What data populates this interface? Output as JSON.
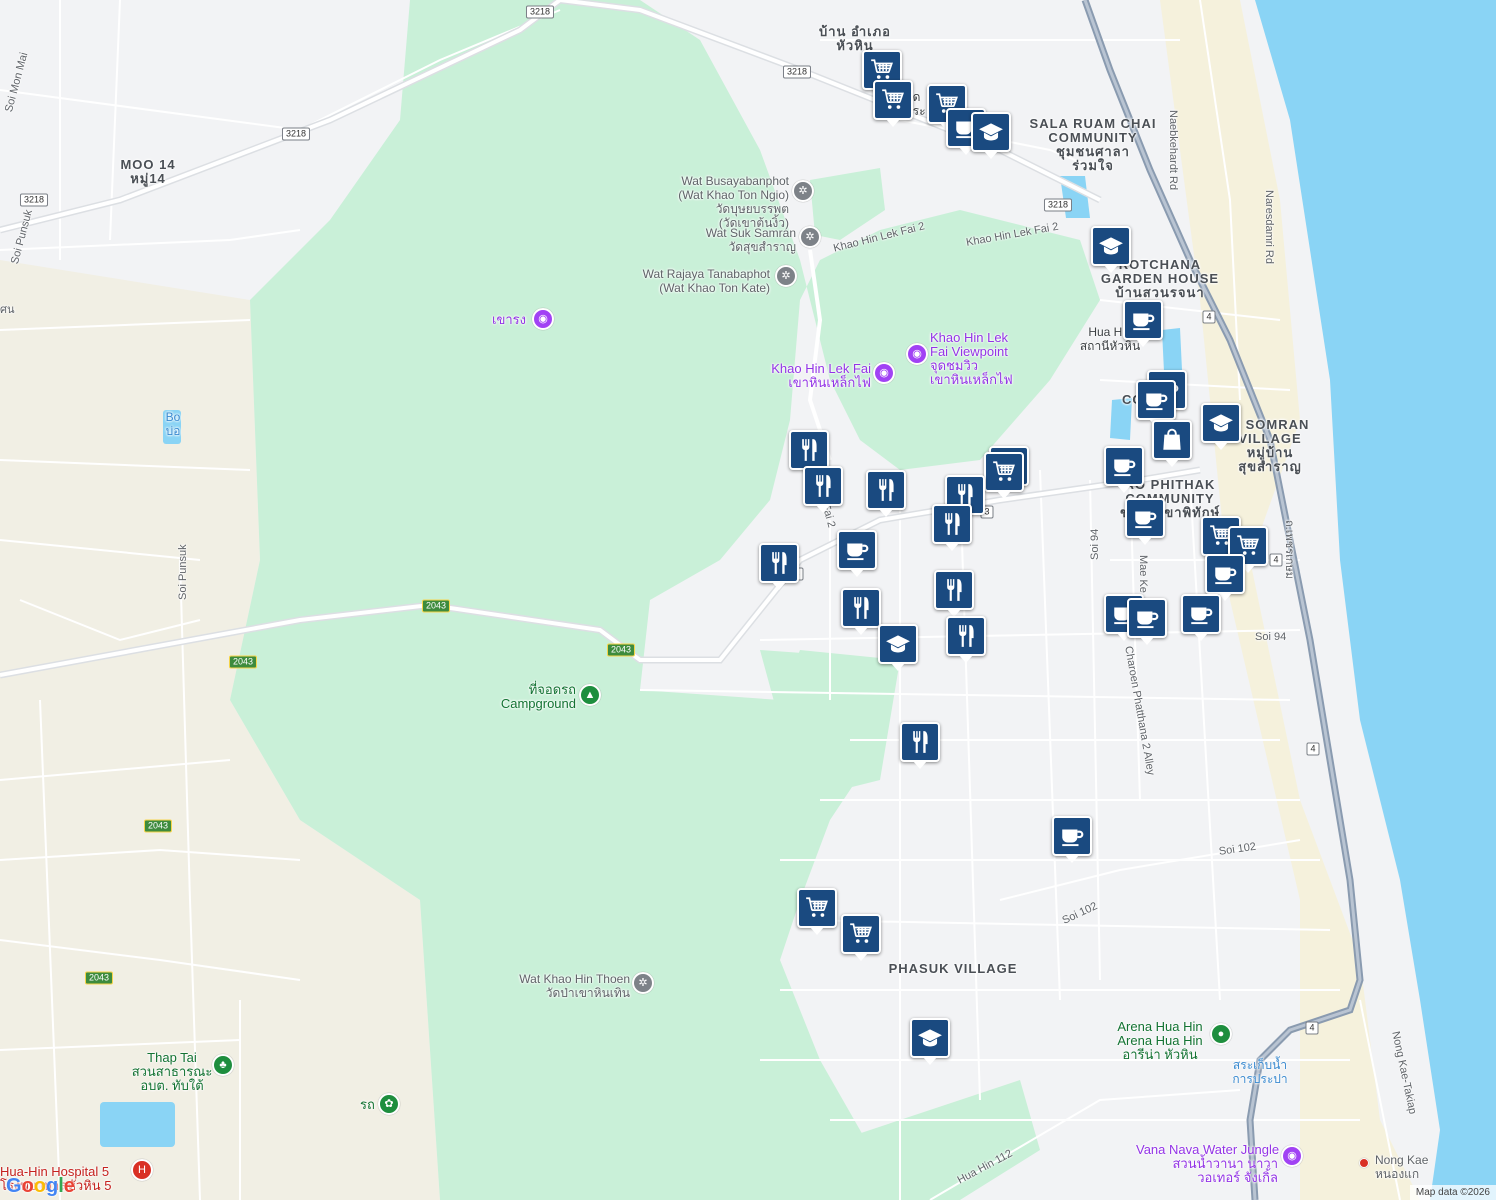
{
  "map": {
    "area_labels": [
      {
        "id": "ban-amphoe",
        "line1": "บ้าน อำเภอ",
        "line2": "หัวหิน"
      },
      {
        "id": "moo14",
        "line1": "MOO 14",
        "line2": "หมู่14"
      },
      {
        "id": "sala-ruam-chai",
        "line1": "SALA RUAM CHAI",
        "line2": "COMMUNITY",
        "line3": "ชุมชนศาลา",
        "line4": "ร่วมใจ"
      },
      {
        "id": "rotchana",
        "line1": "ROTCHANA",
        "line2": "GARDEN HOUSE",
        "line3": "บ้านสวนรจนา"
      },
      {
        "id": "somran",
        "line1": "K SOMRAN",
        "line2": "VILLAGE",
        "line3": "หมู่บ้าน",
        "line4": "สุขสำราญ"
      },
      {
        "id": "phithak",
        "line1": "AO PHITHAK",
        "line2": "COMMUNITY",
        "line3": "ชุมชนเขาพิทักษ์"
      },
      {
        "id": "phasuk",
        "line1": "PHASUK VILLAGE"
      },
      {
        "id": "con",
        "line1": "CON"
      }
    ],
    "poi_labels": [
      {
        "id": "wat-busaya",
        "line1": "Wat Busayabanphot",
        "line2": "(Wat Khao Ton Ngio)",
        "line3": "วัดบุษยบรรพต",
        "line4": "(วัดเขาต้นงิ้ว)",
        "icon": "temple-icon"
      },
      {
        "id": "wat-suk",
        "line1": "Wat Suk Samran",
        "line2": "วัดสุขสำราญ",
        "icon": "temple-icon"
      },
      {
        "id": "wat-rajaya",
        "line1": "Wat Rajaya Tanabaphot",
        "line2": "(Wat Khao Ton Kate)",
        "icon": "temple-icon"
      },
      {
        "id": "khao-rang",
        "line1": "เขารง",
        "icon": "camera-icon"
      },
      {
        "id": "viewpoint",
        "line1": "Khao Hin Lek",
        "line2": "Fai Viewpoint",
        "line3": "จุดชมวิว",
        "line4": "เขาหินเหล็กไฟ",
        "icon": "camera-icon"
      },
      {
        "id": "khao-hin",
        "line1": "Khao Hin Lek Fai",
        "line2": "เขาหินเหล็กไฟ",
        "icon": "camera-icon"
      },
      {
        "id": "campground",
        "line1": "ที่จอดรถ",
        "line2": "Campground",
        "icon": "tent-icon"
      },
      {
        "id": "wat-thoen",
        "line1": "Wat Khao Hin Thoen",
        "line2": "วัดป่าเขาหินเทิน",
        "icon": "temple-icon"
      },
      {
        "id": "thap-tai",
        "line1": "Thap Tai",
        "line2": "สวนสาธารณะ",
        "line3": "อบต. ทับใต้",
        "icon": "park-icon"
      },
      {
        "id": "rot",
        "line1": "รถ",
        "icon": "flower-icon"
      },
      {
        "id": "hospital",
        "line1": "Hua-Hin Hospital 5",
        "line2": "โรงพยาบาลหัวหิน 5",
        "icon": "hospital-icon"
      },
      {
        "id": "arena",
        "line1": "Arena Hua Hin",
        "line2": "Arena Hua Hin",
        "line3": "อารีน่า หัวหิน",
        "icon": "stadium-icon"
      },
      {
        "id": "water",
        "line1": "สระเก็บน้ำ",
        "line2": "การประปา"
      },
      {
        "id": "vana-nava",
        "line1": "Vana Nava Water Jungle",
        "line2": "สวนน้ำวานา นาวา",
        "line3": "วอเทอร์ จังเกิ้ล",
        "icon": "waterpark-icon"
      },
      {
        "id": "nong-kae",
        "line1": "Nong Kae",
        "line2": "หนองแก",
        "icon": "pin-icon"
      },
      {
        "id": "hua-hin-station",
        "line1": "Hua Hin",
        "line2": "สถานีหัวหิน"
      },
      {
        "id": "bo",
        "line1": "Bo",
        "line2": "บ่อ"
      },
      {
        "id": "ban-prachuap",
        "line1": "บด",
        "line2": "ประ"
      }
    ],
    "road_labels": [
      "Soi Mon Mai",
      "Soi Punsuk",
      "Soi Punsuk",
      "Khao Hin Lek Fai 2",
      "Khao Hin Lek Fai 2",
      "Naebkehardt Rd",
      "Naresdamri Rd",
      "Soi 94",
      "Soi 94",
      "Mae Ke",
      "Charoen Phatthana 2 Alley",
      "Soi 102",
      "Soi 102",
      "Hua Hin 112",
      "Nong Kae-Takiap",
      "ถ.เพชรเกษม",
      "Fai 2",
      "ศน"
    ],
    "shields": [
      "3218",
      "3218",
      "3218",
      "3218",
      "3218",
      "2043",
      "2043",
      "2043",
      "2043",
      "2043",
      "4",
      "4",
      "4",
      "4",
      "3",
      "3"
    ],
    "markers": [
      {
        "type": "shopping-cart"
      },
      {
        "type": "shopping-cart"
      },
      {
        "type": "shopping-cart"
      },
      {
        "type": "coffee"
      },
      {
        "type": "school"
      },
      {
        "type": "school"
      },
      {
        "type": "coffee"
      },
      {
        "type": "coffee"
      },
      {
        "type": "coffee"
      },
      {
        "type": "school"
      },
      {
        "type": "shopping-bag"
      },
      {
        "type": "coffee"
      },
      {
        "type": "shopping-cart"
      },
      {
        "type": "shopping-cart"
      },
      {
        "type": "restaurant"
      },
      {
        "type": "restaurant"
      },
      {
        "type": "restaurant"
      },
      {
        "type": "restaurant"
      },
      {
        "type": "restaurant"
      },
      {
        "type": "restaurant"
      },
      {
        "type": "coffee"
      },
      {
        "type": "restaurant"
      },
      {
        "type": "restaurant"
      },
      {
        "type": "school"
      },
      {
        "type": "restaurant"
      },
      {
        "type": "coffee"
      },
      {
        "type": "shopping-cart"
      },
      {
        "type": "shopping-cart"
      },
      {
        "type": "coffee"
      },
      {
        "type": "coffee"
      },
      {
        "type": "coffee"
      },
      {
        "type": "coffee"
      },
      {
        "type": "restaurant"
      },
      {
        "type": "coffee"
      },
      {
        "type": "shopping-cart"
      },
      {
        "type": "shopping-cart"
      },
      {
        "type": "school"
      }
    ],
    "colors": {
      "park": "#c9f0d8",
      "sea": "#8ad4f5",
      "land": "#f2f3f5",
      "sand": "#f1efe4",
      "highway": "#8a9bb0",
      "marker": "#1a4a80"
    },
    "logo": "Google",
    "attribution": "Map data ©2026"
  }
}
